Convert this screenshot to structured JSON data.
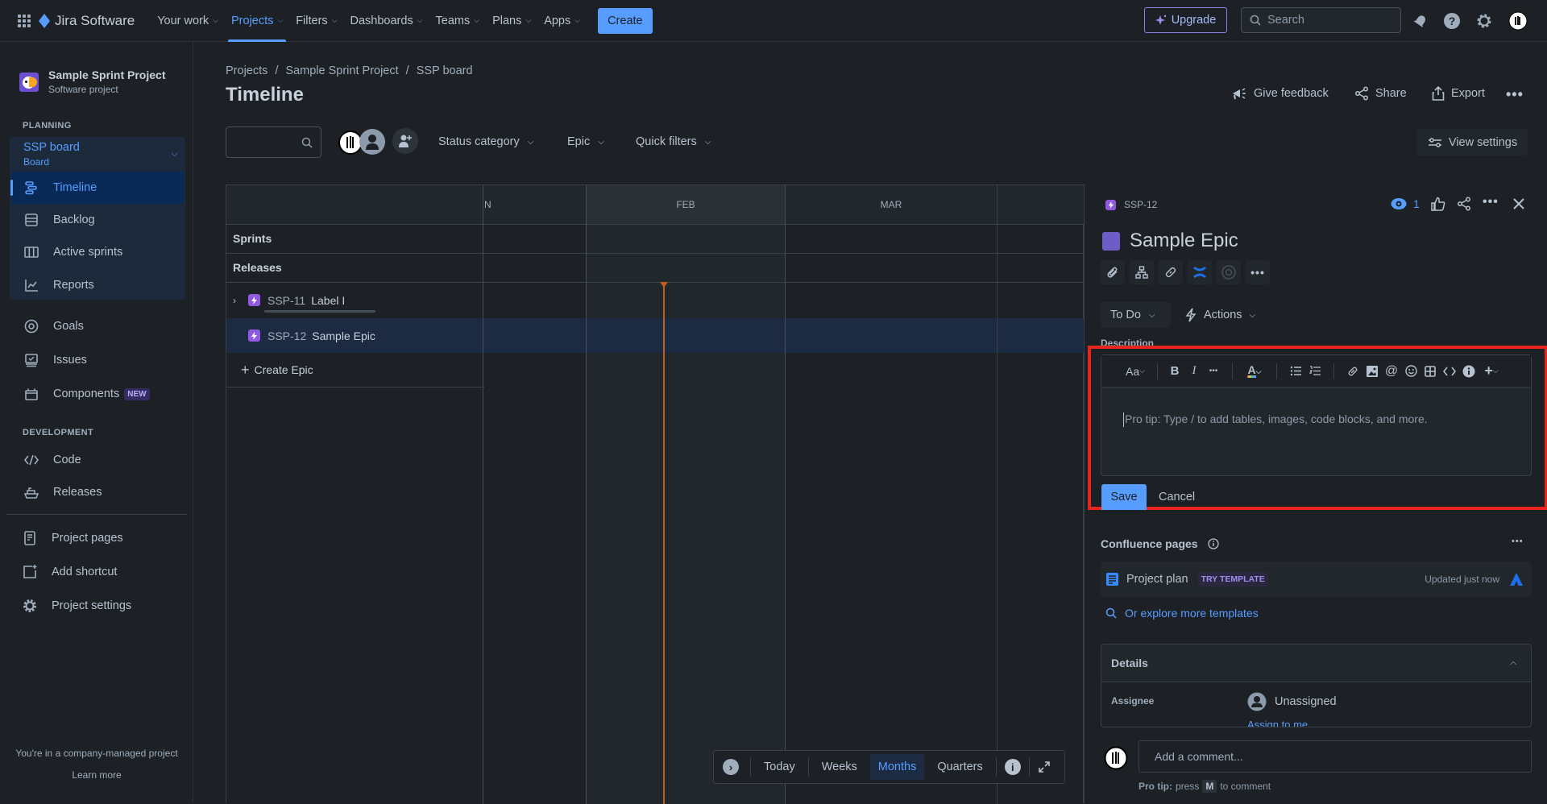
{
  "topnav": {
    "app_name": "Jira Software",
    "items": [
      {
        "label": "Your work"
      },
      {
        "label": "Projects",
        "active": true
      },
      {
        "label": "Filters"
      },
      {
        "label": "Dashboards"
      },
      {
        "label": "Teams"
      },
      {
        "label": "Plans"
      },
      {
        "label": "Apps"
      }
    ],
    "create_label": "Create",
    "upgrade_label": "Upgrade",
    "search_placeholder": "Search"
  },
  "sidebar": {
    "project_name": "Sample Sprint Project",
    "project_type": "Software project",
    "planning_label": "PLANNING",
    "board_name": "SSP board",
    "board_type": "Board",
    "planning_items": [
      {
        "label": "Timeline",
        "icon": "timeline-icon",
        "active": true
      },
      {
        "label": "Backlog",
        "icon": "backlog-icon"
      },
      {
        "label": "Active sprints",
        "icon": "board-columns-icon"
      },
      {
        "label": "Reports",
        "icon": "reports-icon"
      }
    ],
    "other_items": [
      {
        "label": "Goals",
        "icon": "goals-icon"
      },
      {
        "label": "Issues",
        "icon": "issues-icon"
      },
      {
        "label": "Components",
        "icon": "components-icon",
        "badge": "NEW"
      }
    ],
    "development_label": "DEVELOPMENT",
    "development_items": [
      {
        "label": "Code",
        "icon": "code-icon"
      },
      {
        "label": "Releases",
        "icon": "releases-icon"
      }
    ],
    "bottom_items": [
      {
        "label": "Project pages",
        "icon": "page-icon"
      },
      {
        "label": "Add shortcut",
        "icon": "add-shortcut-icon"
      },
      {
        "label": "Project settings",
        "icon": "gear-icon"
      }
    ],
    "footer_text": "You're in a company-managed project",
    "footer_link": "Learn more"
  },
  "main": {
    "breadcrumb": [
      "Projects",
      "Sample Sprint Project",
      "SSP board"
    ],
    "title": "Timeline",
    "actions": {
      "feedback": "Give feedback",
      "share": "Share",
      "export": "Export"
    },
    "filters": {
      "status_category": "Status category",
      "epic": "Epic",
      "quick_filters": "Quick filters",
      "view_settings": "View settings"
    },
    "timeline": {
      "months": [
        "N",
        "FEB",
        "MAR"
      ],
      "rows": {
        "sprints": "Sprints",
        "releases": "Releases"
      },
      "epics": [
        {
          "key": "SSP-11",
          "title": "Label I",
          "expandable": true
        },
        {
          "key": "SSP-12",
          "title": "Sample Epic",
          "selected": true
        }
      ],
      "create_epic": "Create Epic",
      "today_color": "#f18d13"
    },
    "zoombar": {
      "today": "Today",
      "weeks": "Weeks",
      "months": "Months",
      "quarters": "Quarters",
      "active": "Months"
    }
  },
  "panel": {
    "issue_key": "SSP-12",
    "watch_count": "1",
    "title": "Sample Epic",
    "epic_color": "#6e5dc6",
    "status": "To Do",
    "actions_label": "Actions",
    "description_label": "Description",
    "editor_placeholder": "Pro tip: Type / to add tables, images, code blocks, and more.",
    "save_label": "Save",
    "cancel_label": "Cancel",
    "confluence_label": "Confluence pages",
    "confluence_page": "Project plan",
    "try_template": "TRY TEMPLATE",
    "updated": "Updated just now",
    "explore_link": "Or explore more templates",
    "details_label": "Details",
    "assignee_label": "Assignee",
    "assignee_value": "Unassigned",
    "assign_to_me": "Assign to me",
    "comment_placeholder": "Add a comment...",
    "pro_tip_bold": "Pro tip:",
    "pro_tip_press": "press",
    "pro_tip_key": "M",
    "pro_tip_rest": "to comment",
    "highlight_color": "#e8261c"
  }
}
